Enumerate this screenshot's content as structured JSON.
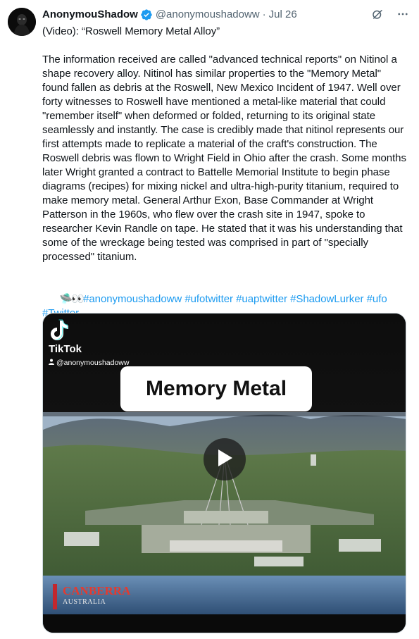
{
  "author": {
    "display_name": "AnonymouShadow",
    "handle": "@anonymoushadoww",
    "separator": "·",
    "date": "Jul 26"
  },
  "icons": {
    "verified": "verified-badge-icon",
    "grok": "grok-icon",
    "more": "more-icon",
    "play": "play-icon",
    "tiktok": "tiktok-logo-icon",
    "user": "user-icon"
  },
  "colors": {
    "text": "#0f1419",
    "muted": "#536471",
    "link": "#1d9bf0",
    "verified": "#1d9bf0"
  },
  "post": {
    "title_line": "(Video): “Roswell Memory Metal Alloy”",
    "body": "The information received are called \"advanced technical reports\" on Nitinol a shape recovery alloy. Nitinol has similar properties to the \"Memory Metal\" found fallen as debris at the Roswell, New Mexico Incident of 1947. Well over forty witnesses to Roswell have mentioned a metal-like material that could \"remember itself\" when deformed or folded, returning to its original state seamlessly and instantly. The case is credibly made that nitinol represents our first attempts made to replicate a material of the craft's construction. The Roswell debris was flown to Wright Field in Ohio after the crash. Some months later Wright granted a contract to Battelle Memorial Institute to begin phase diagrams (recipes) for mixing nickel and ultra-high-purity titanium, required to make memory metal. General Arthur Exon, Base Commander at Wright Patterson in the 1960s, who flew over the crash site in 1947, spoke to researcher Kevin Randle on tape. He stated that it was his understanding that some of the wreckage being tested was comprised in part of \"specially processed\" titanium.",
    "emoji": "🛸👀",
    "hashtags": [
      "#anonymoushadoww",
      "#ufotwitter",
      "#uaptwitter",
      "#ShadowLurker",
      "#ufo",
      "#Twitter"
    ]
  },
  "video": {
    "brand": "TikTok",
    "watermark_user": "@anonymoushadoww",
    "caption": "Memory Metal",
    "location_name": "CANBERRA",
    "location_sub": "AUSTRALIA"
  }
}
